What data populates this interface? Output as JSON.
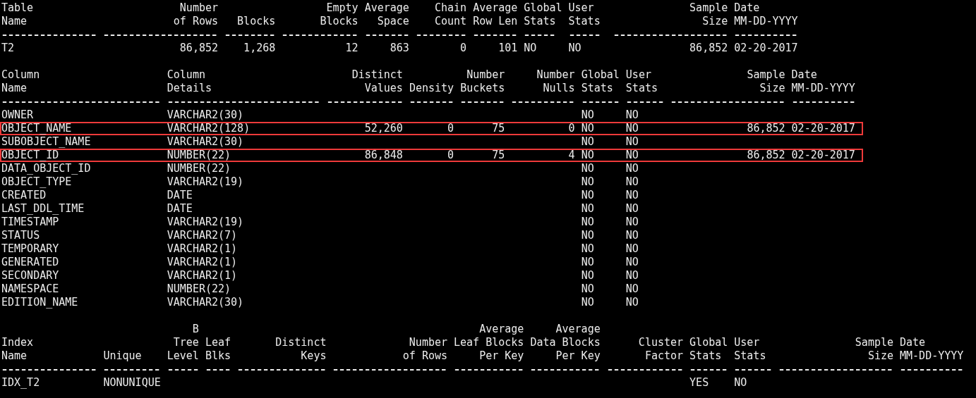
{
  "sections": [
    {
      "kind": "table_stats",
      "columns": [
        {
          "heading": [
            "Table",
            "Name"
          ]
        },
        {
          "heading": [
            "Number",
            "of Rows"
          ]
        },
        {
          "heading": [
            "Blocks"
          ]
        },
        {
          "heading": [
            "Empty",
            "Blocks"
          ]
        },
        {
          "heading": [
            "Average",
            "Space"
          ]
        },
        {
          "heading": [
            "Chain",
            "Count"
          ]
        },
        {
          "heading": [
            "Average",
            "Row Len"
          ]
        },
        {
          "heading": [
            "Global",
            "Stats"
          ]
        },
        {
          "heading": [
            "User",
            "Stats"
          ]
        },
        {
          "heading": [
            "Sample",
            "Size"
          ]
        },
        {
          "heading": [
            "Date",
            "MM-DD-YYYY"
          ]
        }
      ],
      "rows": [
        {
          "highlighted": false,
          "cells": [
            "T2",
            "86,852",
            "1,268",
            "12",
            "863",
            "0",
            "101",
            "NO",
            "NO",
            "86,852",
            "02-20-2017"
          ]
        }
      ]
    },
    {
      "kind": "column_stats",
      "columns": [
        {
          "heading": [
            "Column",
            "Name"
          ]
        },
        {
          "heading": [
            "Column",
            "Details"
          ]
        },
        {
          "heading": [
            "Distinct",
            "Values"
          ]
        },
        {
          "heading": [
            "Density"
          ]
        },
        {
          "heading": [
            "Number",
            "Buckets"
          ]
        },
        {
          "heading": [
            "Number",
            "Nulls"
          ]
        },
        {
          "heading": [
            "Global",
            "Stats"
          ]
        },
        {
          "heading": [
            "User",
            "Stats"
          ]
        },
        {
          "heading": [
            "Sample",
            "Size"
          ]
        },
        {
          "heading": [
            "Date",
            "MM-DD-YYYY"
          ]
        }
      ],
      "rows": [
        {
          "highlighted": false,
          "cells": [
            "OWNER",
            "VARCHAR2(30)",
            null,
            null,
            null,
            null,
            "NO",
            "NO",
            null,
            null
          ]
        },
        {
          "highlighted": true,
          "cells": [
            "OBJECT_NAME",
            "VARCHAR2(128)",
            "52,260",
            "0",
            "75",
            "0",
            "NO",
            "NO",
            "86,852",
            "02-20-2017"
          ]
        },
        {
          "highlighted": false,
          "cells": [
            "SUBOBJECT_NAME",
            "VARCHAR2(30)",
            null,
            null,
            null,
            null,
            "NO",
            "NO",
            null,
            null
          ]
        },
        {
          "highlighted": true,
          "cells": [
            "OBJECT_ID",
            "NUMBER(22)",
            "86,848",
            "0",
            "75",
            "4",
            "NO",
            "NO",
            "86,852",
            "02-20-2017"
          ]
        },
        {
          "highlighted": false,
          "cells": [
            "DATA_OBJECT_ID",
            "NUMBER(22)",
            null,
            null,
            null,
            null,
            "NO",
            "NO",
            null,
            null
          ]
        },
        {
          "highlighted": false,
          "cells": [
            "OBJECT_TYPE",
            "VARCHAR2(19)",
            null,
            null,
            null,
            null,
            "NO",
            "NO",
            null,
            null
          ]
        },
        {
          "highlighted": false,
          "cells": [
            "CREATED",
            "DATE",
            null,
            null,
            null,
            null,
            "NO",
            "NO",
            null,
            null
          ]
        },
        {
          "highlighted": false,
          "cells": [
            "LAST_DDL_TIME",
            "DATE",
            null,
            null,
            null,
            null,
            "NO",
            "NO",
            null,
            null
          ]
        },
        {
          "highlighted": false,
          "cells": [
            "TIMESTAMP",
            "VARCHAR2(19)",
            null,
            null,
            null,
            null,
            "NO",
            "NO",
            null,
            null
          ]
        },
        {
          "highlighted": false,
          "cells": [
            "STATUS",
            "VARCHAR2(7)",
            null,
            null,
            null,
            null,
            "NO",
            "NO",
            null,
            null
          ]
        },
        {
          "highlighted": false,
          "cells": [
            "TEMPORARY",
            "VARCHAR2(1)",
            null,
            null,
            null,
            null,
            "NO",
            "NO",
            null,
            null
          ]
        },
        {
          "highlighted": false,
          "cells": [
            "GENERATED",
            "VARCHAR2(1)",
            null,
            null,
            null,
            null,
            "NO",
            "NO",
            null,
            null
          ]
        },
        {
          "highlighted": false,
          "cells": [
            "SECONDARY",
            "VARCHAR2(1)",
            null,
            null,
            null,
            null,
            "NO",
            "NO",
            null,
            null
          ]
        },
        {
          "highlighted": false,
          "cells": [
            "NAMESPACE",
            "NUMBER(22)",
            null,
            null,
            null,
            null,
            "NO",
            "NO",
            null,
            null
          ]
        },
        {
          "highlighted": false,
          "cells": [
            "EDITION_NAME",
            "VARCHAR2(30)",
            null,
            null,
            null,
            null,
            "NO",
            "NO",
            null,
            null
          ]
        }
      ]
    },
    {
      "kind": "index_stats",
      "columns": [
        {
          "heading": [
            "Index",
            "Name"
          ]
        },
        {
          "heading": [
            "Unique"
          ]
        },
        {
          "heading": [
            "B",
            "Tree",
            "Level"
          ]
        },
        {
          "heading": [
            "Leaf",
            "Blks"
          ]
        },
        {
          "heading": [
            "Distinct",
            "Keys"
          ]
        },
        {
          "heading": [
            "Number",
            "of Rows"
          ]
        },
        {
          "heading": [
            "Average",
            "Leaf Blocks",
            "Per Key"
          ]
        },
        {
          "heading": [
            "Average",
            "Data Blocks",
            "Per Key"
          ]
        },
        {
          "heading": [
            "Cluster",
            "Factor"
          ]
        },
        {
          "heading": [
            "Global",
            "Stats"
          ]
        },
        {
          "heading": [
            "User",
            "Stats"
          ]
        },
        {
          "heading": [
            "Sample",
            "Size"
          ]
        },
        {
          "heading": [
            "Date",
            "MM-DD-YYYY"
          ]
        }
      ],
      "rows": [
        {
          "highlighted": false,
          "cells": [
            "IDX_T2",
            "NONUNIQUE",
            null,
            null,
            null,
            null,
            null,
            null,
            null,
            "YES",
            "NO",
            null,
            null
          ]
        }
      ]
    }
  ]
}
